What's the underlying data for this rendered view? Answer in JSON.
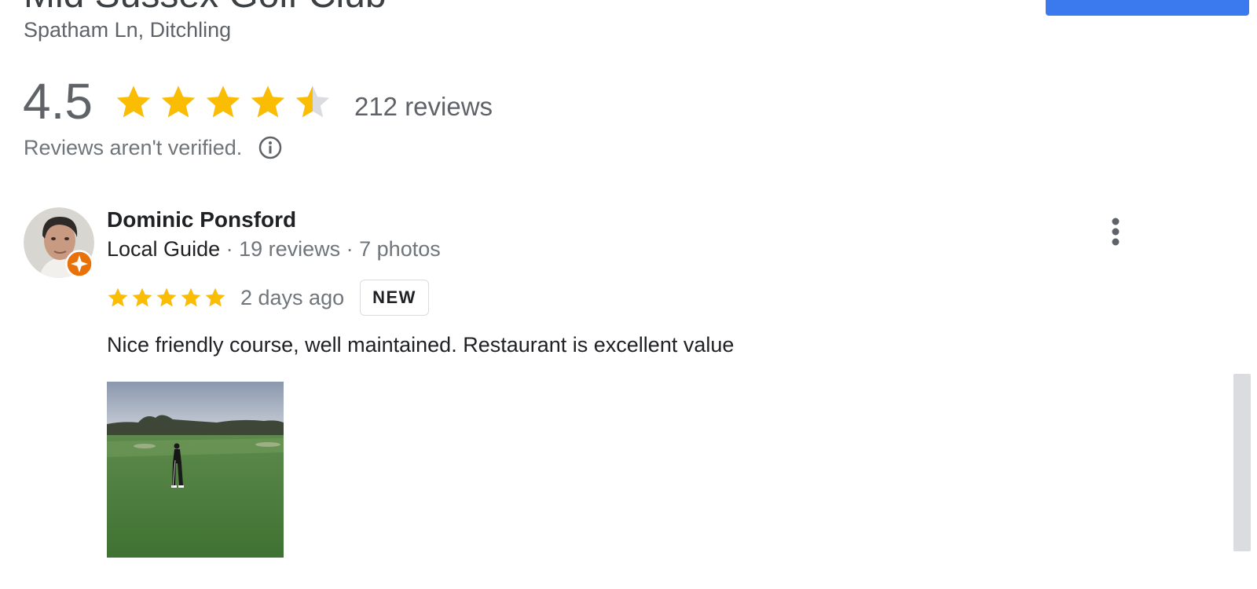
{
  "place": {
    "title": "Mid Sussex Golf Club",
    "address": "Spatham Ln, Ditchling"
  },
  "summary": {
    "rating": "4.5",
    "stars_value": 4.5,
    "review_count": "212 reviews",
    "verification_note": "Reviews aren't verified."
  },
  "review": {
    "author": "Dominic Ponsford",
    "local_guide_label": "Local Guide",
    "meta": " · 19 reviews · 7 photos",
    "stars_value": 5,
    "date": "2 days ago",
    "badge": "NEW",
    "text": "Nice friendly course, well maintained. Restaurant is excellent value"
  },
  "icons": {
    "star": "star-icon",
    "info": "info-icon",
    "more": "more-vert-icon",
    "guide_badge": "local-guide-badge-icon"
  },
  "colors": {
    "star_filled": "#fbbc04",
    "star_empty": "#dadce0",
    "primary_button": "#3a79ee",
    "guide_badge": "#e8710a"
  }
}
